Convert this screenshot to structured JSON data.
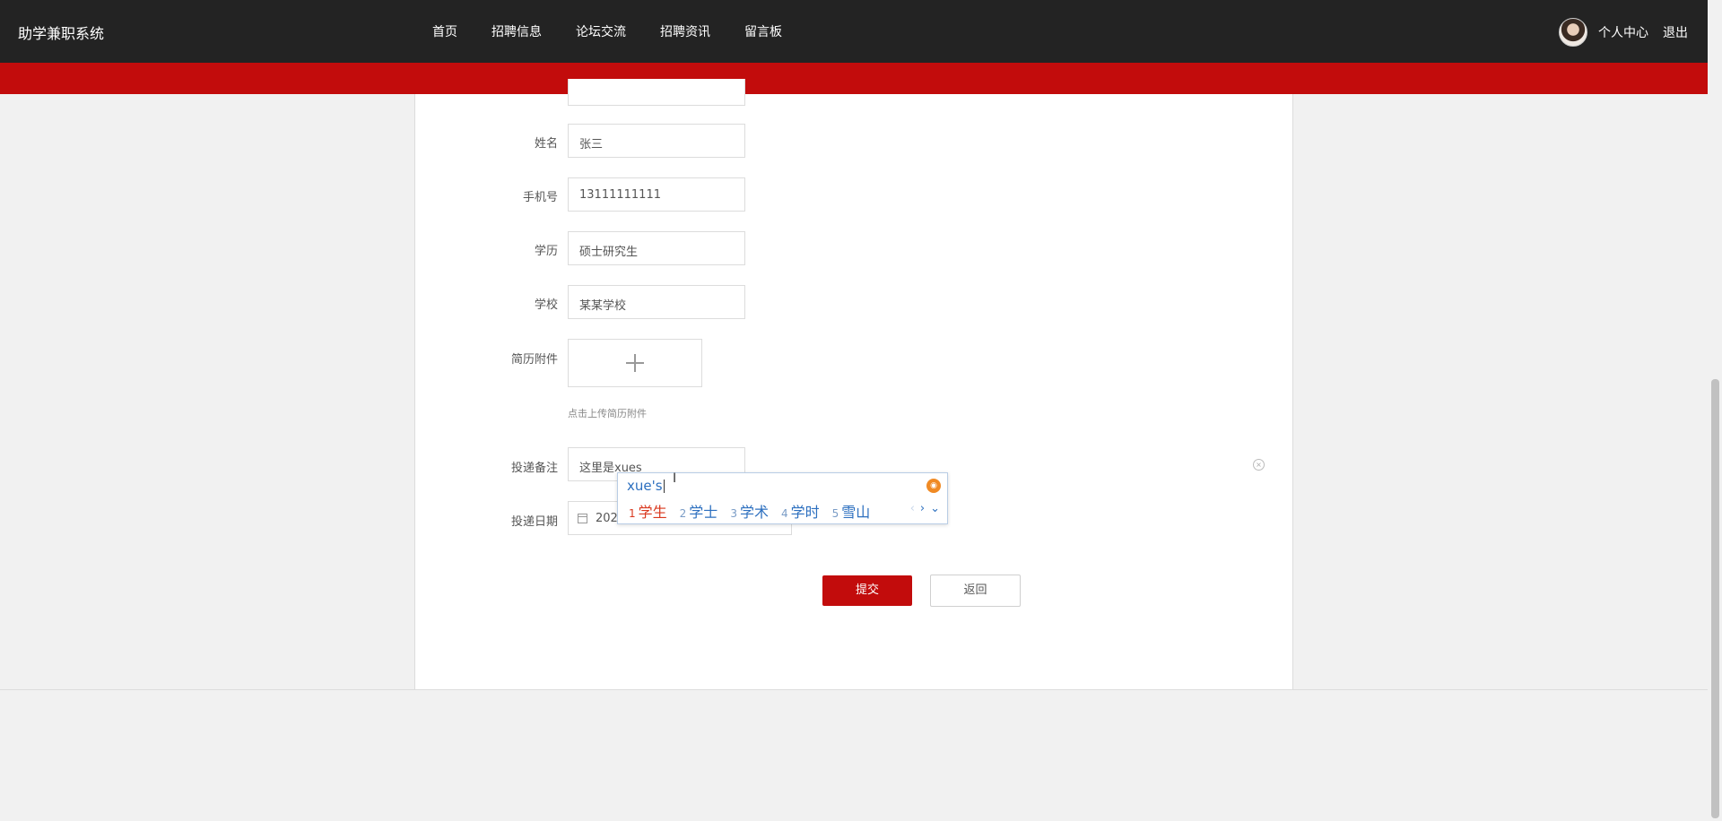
{
  "header": {
    "brand": "助学兼职系统",
    "nav": [
      "首页",
      "招聘信息",
      "论坛交流",
      "招聘资讯",
      "留言板"
    ],
    "user_center": "个人中心",
    "logout": "退出"
  },
  "form": {
    "name_label": "姓名",
    "name_value": "张三",
    "phone_label": "手机号",
    "phone_value": "13111111111",
    "education_label": "学历",
    "education_value": "硕士研究生",
    "school_label": "学校",
    "school_value": "某某学校",
    "resume_label": "简历附件",
    "resume_hint": "点击上传简历附件",
    "remark_label": "投递备注",
    "remark_value": "这里是xues",
    "date_label": "投递日期",
    "date_value": "2024",
    "submit_label": "提交",
    "back_label": "返回"
  },
  "ime": {
    "composition": "xue's",
    "candidates": [
      {
        "num": "1",
        "word": "学生"
      },
      {
        "num": "2",
        "word": "学士"
      },
      {
        "num": "3",
        "word": "学术"
      },
      {
        "num": "4",
        "word": "学时"
      },
      {
        "num": "5",
        "word": "雪山"
      }
    ],
    "prev": "‹",
    "next": "›",
    "expand": "⌄"
  },
  "colors": {
    "topbar": "#232323",
    "accent_red": "#c20c0c",
    "ime_blue": "#2c6fbf"
  }
}
